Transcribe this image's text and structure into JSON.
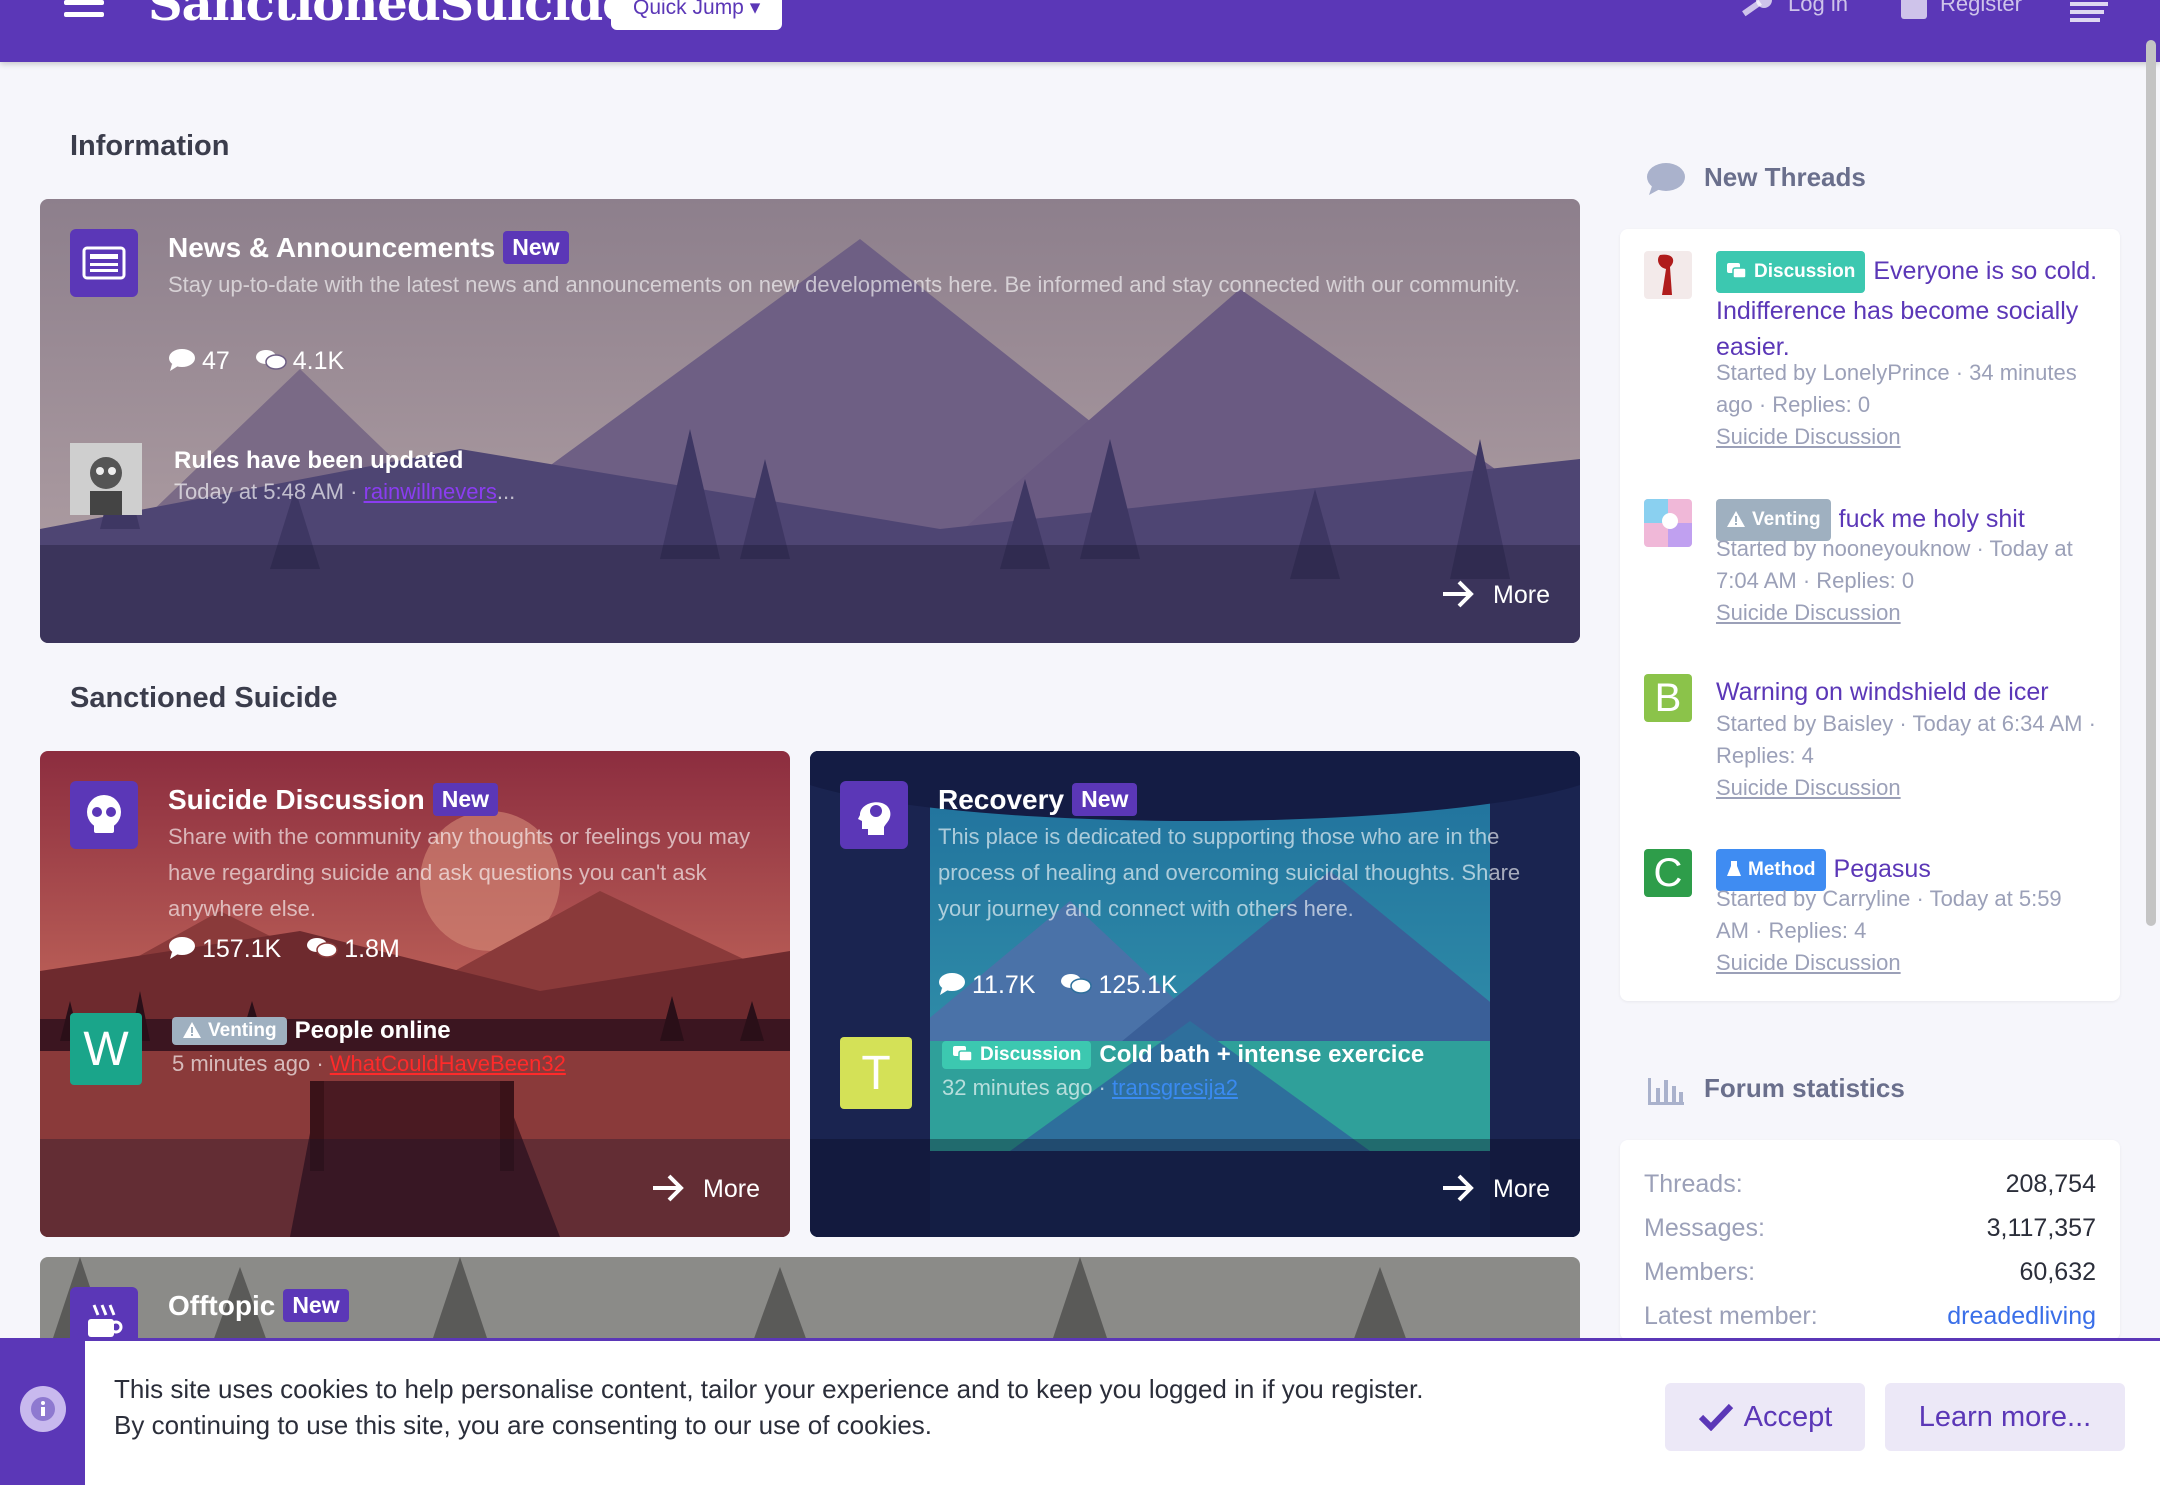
{
  "header": {
    "logo": "SanctionedSuicide.",
    "quick_jump": "Quick Jump",
    "login": "Log in",
    "register": "Register"
  },
  "sections": {
    "information": "Information",
    "sanctioned": "Sanctioned Suicide"
  },
  "forums": {
    "news": {
      "title": "News & Announcements",
      "badge": "New",
      "description": "Stay up-to-date with the latest news and announcements on new developments here. Be informed and stay connected with our community.",
      "messages": "47",
      "threads": "4.1K",
      "latest_title": "Rules have been updated",
      "latest_time": "Today at 5:48 AM",
      "latest_user": "rainwillnevers",
      "latest_user_suffix": "...",
      "more": "More"
    },
    "suicide": {
      "title": "Suicide Discussion",
      "badge": "New",
      "description": "Share with the community any thoughts or feelings you may have regarding suicide and ask questions you can't ask anywhere else.",
      "messages": "157.1K",
      "threads": "1.8M",
      "latest_prefix": "Venting",
      "latest_title": "People online",
      "latest_time": "5 minutes ago",
      "latest_user": "WhatCouldHaveBeen32",
      "avatar_letter": "W",
      "more": "More"
    },
    "recovery": {
      "title": "Recovery",
      "badge": "New",
      "description": "This place is dedicated to supporting those who are in the process of healing and overcoming suicidal thoughts. Share your journey and connect with others here.",
      "messages": "11.7K",
      "threads": "125.1K",
      "latest_prefix": "Discussion",
      "latest_title": "Cold bath + intense exercice",
      "latest_time": "32 minutes ago",
      "latest_user": "transgresija2",
      "avatar_letter": "T",
      "more": "More"
    },
    "offtopic": {
      "title": "Offtopic",
      "badge": "New"
    }
  },
  "new_threads": {
    "title": "New Threads",
    "items": [
      {
        "prefix": "Discussion",
        "title": "Everyone is so cold. Indifference has become socially easier.",
        "meta": "Started by LonelyPrince · 34 minutes ago · Replies: 0",
        "forum": "Suicide Discussion"
      },
      {
        "prefix": "Venting",
        "title": "fuck me holy shit",
        "meta": "Started by nooneyouknow · Today at 7:04 AM · Replies: 0",
        "forum": "Suicide Discussion"
      },
      {
        "prefix": "",
        "title": "Warning on windshield de icer",
        "meta": "Started by Baisley · Today at 6:34 AM · Replies: 4",
        "forum": "Suicide Discussion",
        "avatar_letter": "B"
      },
      {
        "prefix": "Method",
        "title": "Pegasus",
        "meta": "Started by Carryline · Today at 5:59 AM · Replies: 4",
        "forum": "Suicide Discussion",
        "avatar_letter": "C"
      }
    ]
  },
  "forum_statistics": {
    "title": "Forum statistics",
    "rows": [
      {
        "label": "Threads:",
        "value": "208,754"
      },
      {
        "label": "Messages:",
        "value": "3,117,357"
      },
      {
        "label": "Members:",
        "value": "60,632"
      },
      {
        "label": "Latest member:",
        "value": "dreadedliving"
      }
    ]
  },
  "cookie": {
    "line1": "This site uses cookies to help personalise content, tailor your experience and to keep you logged in if you register.",
    "line2": "By continuing to use this site, you are consenting to our use of cookies.",
    "accept": "Accept",
    "learn_more": "Learn more..."
  },
  "colors": {
    "brand": "#5b37b7",
    "discussion": "#3cc8b0",
    "venting": "#9fb0c0",
    "method": "#3f8cf2"
  }
}
